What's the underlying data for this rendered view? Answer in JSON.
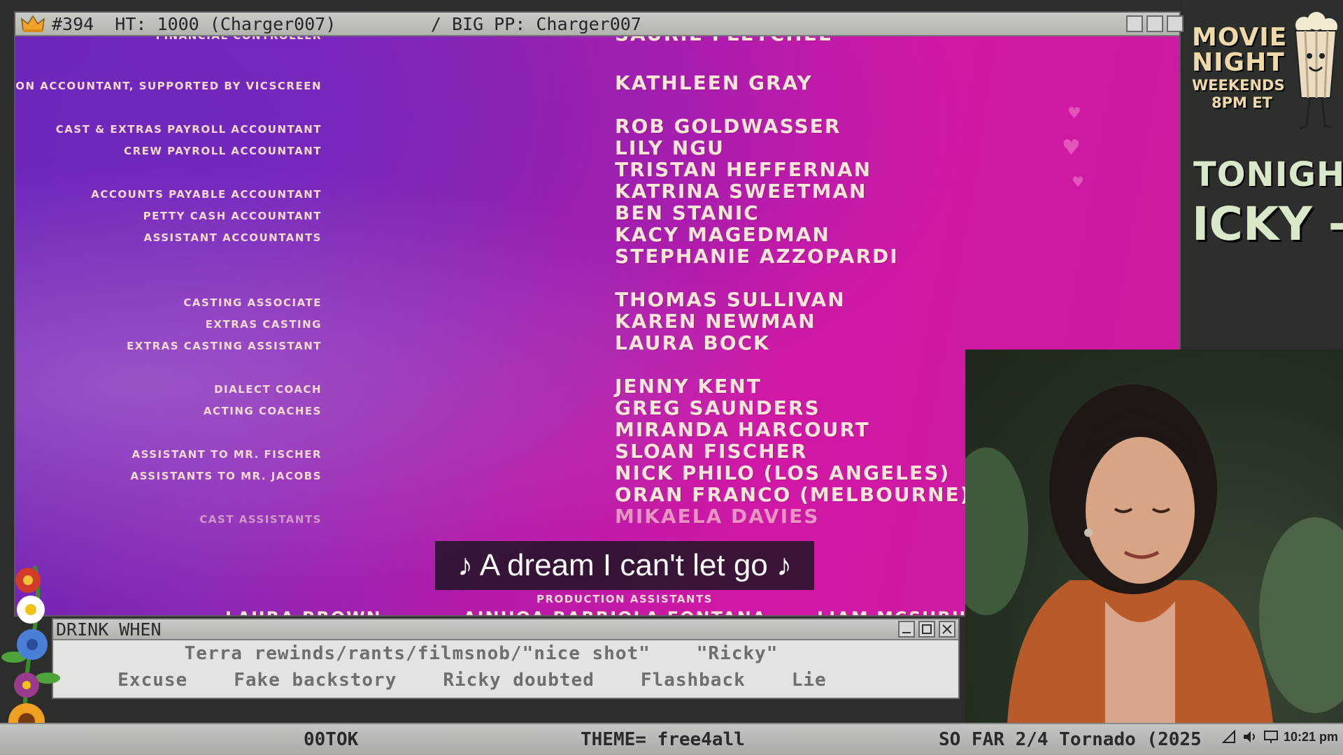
{
  "movie_window": {
    "title": "#394  HT: 1000 (Charger007)         / BIG PP: Charger007",
    "credits": [
      {
        "role": "Financial Controller",
        "names": [
          "Saurie Fletchel"
        ]
      },
      {
        "role": "Production Accountant, supported by Vicscreen",
        "names": [
          "Kathleen Gray"
        ]
      },
      {
        "role": "Cast & Extras Payroll Accountant",
        "names": [
          "Rob Goldwasser"
        ]
      },
      {
        "role": "Crew Payroll Accountant",
        "names": [
          "Lily Ngu",
          "Tristan Heffernan"
        ]
      },
      {
        "role": "Accounts Payable Accountant",
        "names": [
          "Katrina Sweetman"
        ]
      },
      {
        "role": "Petty Cash Accountant",
        "names": [
          "Ben Stanic"
        ]
      },
      {
        "role": "Assistant Accountants",
        "names": [
          "Kacy Magedman",
          "Stephanie Azzopardi"
        ]
      },
      {
        "role": "Casting Associate",
        "names": [
          "Thomas Sullivan"
        ]
      },
      {
        "role": "Extras Casting",
        "names": [
          "Karen Newman"
        ]
      },
      {
        "role": "Extras Casting Assistant",
        "names": [
          "Laura Bock"
        ]
      },
      {
        "role": "Dialect Coach",
        "names": [
          "Jenny Kent"
        ]
      },
      {
        "role": "Acting Coaches",
        "names": [
          "Greg Saunders",
          "Miranda Harcourt"
        ]
      },
      {
        "role": "Assistant to Mr. Fischer",
        "names": [
          "Sloan Fischer"
        ]
      },
      {
        "role": "Assistants to Mr. Jacobs",
        "names": [
          "Nick Philo (Los Angeles)",
          "Oran Franco (Melbourne)"
        ]
      },
      {
        "role": "Cast Assistants",
        "names": [
          "Mikaela Davies"
        ]
      }
    ],
    "section_heading": "Production Assistants",
    "bottom_names": [
      "Laura Brown",
      "Ainhoa Barriola Fontana",
      "Liam McShruca"
    ],
    "subtitle": "♪ A dream I can't let go ♪"
  },
  "drink_window": {
    "title": "DRINK WHEN",
    "row1": [
      "Terra rewinds/rants/filmsnob/\"nice shot\"",
      "\"Ricky\""
    ],
    "row2": [
      "Excuse",
      "Fake backstory",
      "Ricky doubted",
      "Flashback",
      "Lie"
    ]
  },
  "status_bar": {
    "left": "00TOK",
    "center": "THEME= free4all",
    "right": "SO FAR 2/4 Tornado (2025",
    "clock": "10:21 pm"
  },
  "sidebar": {
    "logo_line1": "MOVIE",
    "logo_line2": "NIGHT",
    "logo_line3": "WEEKENDS",
    "logo_line4": "8PM ET",
    "tonight_label": "TONIGHT:",
    "tonight_title": "ICKY -"
  },
  "colors": {
    "credits_magenta": "#cc1aa0",
    "credits_purple": "#6a22b4",
    "credit_text": "#ffe5d8",
    "chrome_gray": "#c4c6c1",
    "sidebar_text": "#d8e8c8"
  }
}
